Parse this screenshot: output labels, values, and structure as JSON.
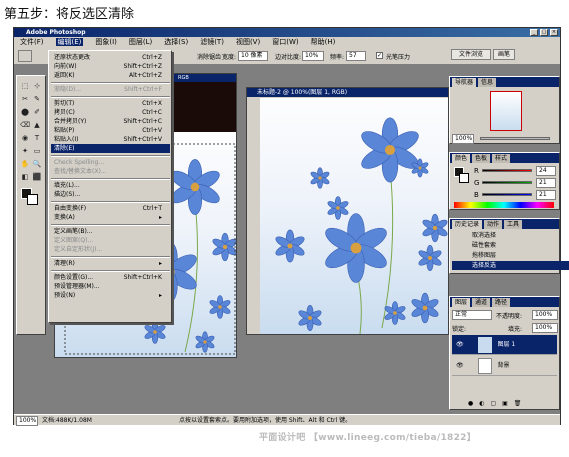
{
  "caption": "第五步：将反选区清除",
  "app_title": "Adobe Photoshop",
  "menubar": [
    "文件(F)",
    "编辑(E)",
    "图象(I)",
    "图层(L)",
    "选择(S)",
    "滤镜(T)",
    "视图(V)",
    "窗口(W)",
    "帮助(H)"
  ],
  "options": {
    "feather_label": "宽度:",
    "feather": "10 像素",
    "edge_label": "边对比度:",
    "edge": "10%",
    "freq_label": "频率:",
    "freq": "57",
    "pressure": "光笔压力",
    "antialias": "消除锯齿"
  },
  "browser_tabs": [
    "文件浏览",
    "画笔"
  ],
  "menu": [
    {
      "label": "还原状态更改",
      "sc": "Ctrl+Z",
      "dis": false
    },
    {
      "label": "向前(W)",
      "sc": "Shift+Ctrl+Z",
      "dis": false
    },
    {
      "label": "返回(K)",
      "sc": "Alt+Ctrl+Z",
      "dis": false
    },
    {
      "sep": true
    },
    {
      "label": "渐隐(D)...",
      "sc": "Shift+Ctrl+F",
      "dis": true
    },
    {
      "sep": true
    },
    {
      "label": "剪切(T)",
      "sc": "Ctrl+X",
      "dis": false
    },
    {
      "label": "拷贝(C)",
      "sc": "Ctrl+C",
      "dis": false
    },
    {
      "label": "合并拷贝(Y)",
      "sc": "Shift+Ctrl+C",
      "dis": false
    },
    {
      "label": "粘贴(P)",
      "sc": "Ctrl+V",
      "dis": false
    },
    {
      "label": "粘贴入(I)",
      "sc": "Shift+Ctrl+V",
      "dis": false
    },
    {
      "label": "清除(E)",
      "sc": "",
      "dis": false,
      "hi": true
    },
    {
      "sep": true
    },
    {
      "label": "Check Spelling...",
      "sc": "",
      "dis": true
    },
    {
      "label": "查找/替换文本(X)...",
      "sc": "",
      "dis": true
    },
    {
      "sep": true
    },
    {
      "label": "填充(L)...",
      "sc": "",
      "dis": false
    },
    {
      "label": "描边(S)...",
      "sc": "",
      "dis": false
    },
    {
      "sep": true
    },
    {
      "label": "自由变换(F)",
      "sc": "Ctrl+T",
      "dis": false
    },
    {
      "label": "变换(A)",
      "sc": "▸",
      "dis": false
    },
    {
      "sep": true
    },
    {
      "label": "定义画笔(B)...",
      "sc": "",
      "dis": false
    },
    {
      "label": "定义图案(Q)...",
      "sc": "",
      "dis": true
    },
    {
      "label": "定义自定形状(J)...",
      "sc": "",
      "dis": true
    },
    {
      "sep": true
    },
    {
      "label": "清理(R)",
      "sc": "▸",
      "dis": false
    },
    {
      "sep": true
    },
    {
      "label": "颜色设置(G)...",
      "sc": "Shift+Ctrl+K",
      "dis": false
    },
    {
      "label": "预设管理器(M)...",
      "sc": "",
      "dis": false
    },
    {
      "label": "预设(N)",
      "sc": "▸",
      "dis": false
    }
  ],
  "doc_left_title": "RGB",
  "doc_right_title": "未标题-2 @ 100%(图层 1, RGB)",
  "navigator": {
    "tabs": [
      "导航器",
      "信息"
    ],
    "zoom": "100%"
  },
  "color": {
    "tabs": [
      "颜色",
      "色板",
      "样式"
    ],
    "r_label": "R",
    "g_label": "G",
    "b_label": "B",
    "r": "24",
    "g": "21",
    "b": "21"
  },
  "history": {
    "tabs": [
      "历史记录",
      "动作",
      "工具"
    ],
    "items": [
      "取消选择",
      "磁性套索",
      "拖移图层",
      "选择反选"
    ]
  },
  "layers": {
    "tabs": [
      "图层",
      "通道",
      "路径"
    ],
    "mode": "正常",
    "opacity_label": "不透明度:",
    "opacity": "100%",
    "lock_label": "锁定:",
    "fill_label": "填充:",
    "fill": "100%",
    "rows": [
      "图层 1",
      "背景"
    ]
  },
  "status": {
    "zoom": "100%",
    "doc": "文档:488K/1.08M",
    "hint": "点按以设置套索点。要用附加选项，使用 Shift、Alt 和 Ctrl 键。"
  },
  "watermark": "平面设计吧 【www.lineeg.com/tieba/1822】"
}
